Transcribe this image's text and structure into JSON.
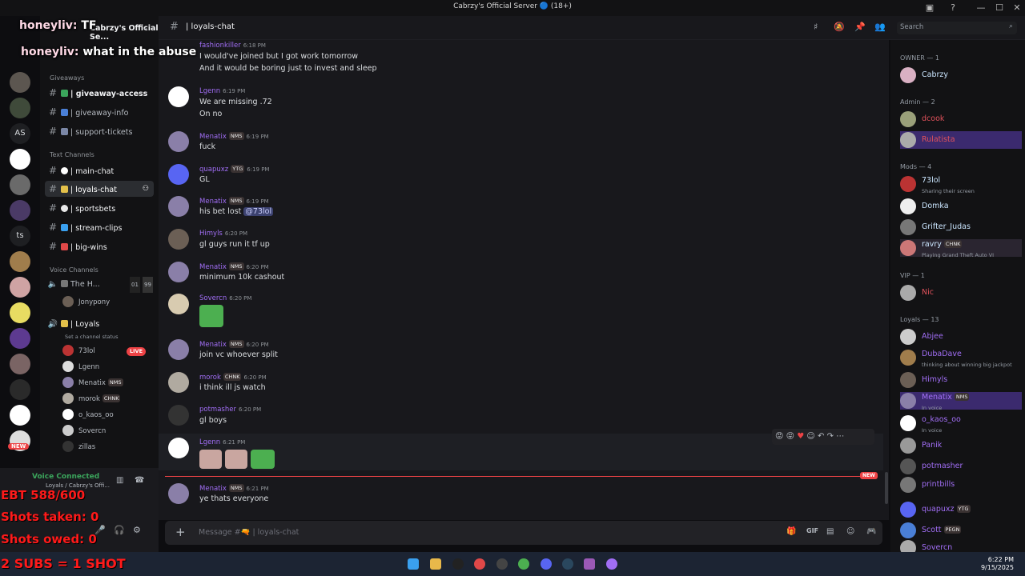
{
  "window": {
    "title": "Cabrzy's Official Server 🔵 (18+)"
  },
  "overlay": {
    "chat1_name": "honeyliv:",
    "chat1_text": "TF",
    "chat2_name": "honeyliv:",
    "chat2_text": "what in the abuse",
    "counter1": "EBT 588/600",
    "counter2": "Shots taken: 0",
    "counter3": "Shots owed: 0",
    "footer": "2 SUBS = 1 SHOT"
  },
  "server": {
    "name": "Cabrzy's Official Se..."
  },
  "servers_rail": {
    "as_label": "AS",
    "ts_label": "ts",
    "new_badge": "NEW"
  },
  "sections": {
    "giveaways": "Giveaways",
    "text": "Text Channels",
    "voice": "Voice Channels"
  },
  "channels": {
    "giveaway_access": "| giveaway-access",
    "giveaway_info": "| giveaway-info",
    "support_tickets": "| support-tickets",
    "main_chat": "| main-chat",
    "loyals_chat": "| loyals-chat",
    "sportsbets": "| sportsbets",
    "stream_clips": "| stream-clips",
    "big_wins": "| big-wins",
    "voice_the_h": "The H...",
    "voice_the_h_count1": "01",
    "voice_the_h_count2": "99",
    "voice_loyals": "| Loyals",
    "voice_loyals_status": "Set a channel status"
  },
  "voice_users": [
    {
      "name": "Jonypony"
    },
    {
      "name": "73lol",
      "badge": "LIVE"
    },
    {
      "name": "Lgenn"
    },
    {
      "name": "Menatix",
      "tag": "NMS"
    },
    {
      "name": "morok",
      "tag": "CHNK"
    },
    {
      "name": "o_kaos_oo"
    },
    {
      "name": "Sovercn"
    },
    {
      "name": "zillas"
    }
  ],
  "userbar": {
    "status": "Voice Connected",
    "channel": "Loyals / Cabrzy's Offi..."
  },
  "header": {
    "channel": "| loyals-chat",
    "search_placeholder": "Search"
  },
  "messages": [
    {
      "author": "fashionkiller",
      "time": "6:18 PM",
      "lines": [
        "I would've joined but I got work tomorrow",
        "And it would be boring just to invest and sleep"
      ]
    },
    {
      "author": "Lgenn",
      "time": "6:19 PM",
      "lines": [
        "We are missing .72",
        "On no"
      ]
    },
    {
      "author": "Menatix",
      "tag": "NMS",
      "time": "6:19 PM",
      "lines": [
        "fuck"
      ]
    },
    {
      "author": "quapuxz",
      "tag": "YTG",
      "time": "6:19 PM",
      "lines": [
        "GL"
      ]
    },
    {
      "author": "Menatix",
      "tag": "NMS",
      "time": "6:19 PM",
      "lines": [
        "his bet lost"
      ],
      "mention": "@73lol"
    },
    {
      "author": "Himyls",
      "time": "6:20 PM",
      "lines": [
        "gl guys run it tf up"
      ]
    },
    {
      "author": "Menatix",
      "tag": "NMS",
      "time": "6:20 PM",
      "lines": [
        "minimum 10k cashout"
      ]
    },
    {
      "author": "Sovercn",
      "time": "6:20 PM",
      "lines": []
    },
    {
      "author": "Menatix",
      "tag": "NMS",
      "time": "6:20 PM",
      "lines": [
        "join vc whoever split"
      ]
    },
    {
      "author": "morok",
      "tag": "CHNK",
      "time": "6:20 PM",
      "lines": [
        "i think ill js watch"
      ]
    },
    {
      "author": "potmasher",
      "time": "6:20 PM",
      "lines": [
        "gl boys"
      ]
    },
    {
      "author": "Lgenn",
      "time": "6:21 PM",
      "lines": []
    },
    {
      "author": "Menatix",
      "tag": "NMS",
      "time": "6:21 PM",
      "lines": [
        "ye thats everyone"
      ]
    }
  ],
  "new_divider": "NEW",
  "composer": {
    "placeholder": "Message #🔫 | loyals-chat"
  },
  "members": {
    "owner_header": "OWNER — 1",
    "admin_header": "Admin — 2",
    "mods_header": "Mods — 4",
    "vip_header": "VIP — 1",
    "loyals_header": "Loyals — 13",
    "owner": [
      {
        "name": "Cabrzy"
      }
    ],
    "admins": [
      {
        "name": "dcook"
      },
      {
        "name": "Rulatista"
      }
    ],
    "mods": [
      {
        "name": "73lol",
        "status": "Sharing their screen"
      },
      {
        "name": "Domka"
      },
      {
        "name": "Grifter_Judas"
      },
      {
        "name": "ravry",
        "tag": "CHNK",
        "status": "Playing Grand Theft Auto VI"
      }
    ],
    "vip": [
      {
        "name": "Nic"
      }
    ],
    "loyals": [
      {
        "name": "Abjee"
      },
      {
        "name": "DubaDave",
        "status": "thinking about winning big jackpot"
      },
      {
        "name": "Himyls"
      },
      {
        "name": "Menatix",
        "tag": "NMS",
        "status": "In voice"
      },
      {
        "name": "o_kaos_oo",
        "status": "In voice"
      },
      {
        "name": "Panik"
      },
      {
        "name": "potmasher"
      },
      {
        "name": "printbills"
      },
      {
        "name": "quapuxz",
        "tag": "YTG"
      },
      {
        "name": "Scott",
        "tag": "PEGN"
      },
      {
        "name": "Sovercn"
      }
    ]
  },
  "taskbar": {
    "time": "6:22 PM",
    "date": "9/15/2025"
  },
  "colors": {
    "admin": "#e0515b",
    "owner_mod": "#cbe6ff",
    "loyal": "#a16ef5",
    "vip": "#e0515b"
  }
}
